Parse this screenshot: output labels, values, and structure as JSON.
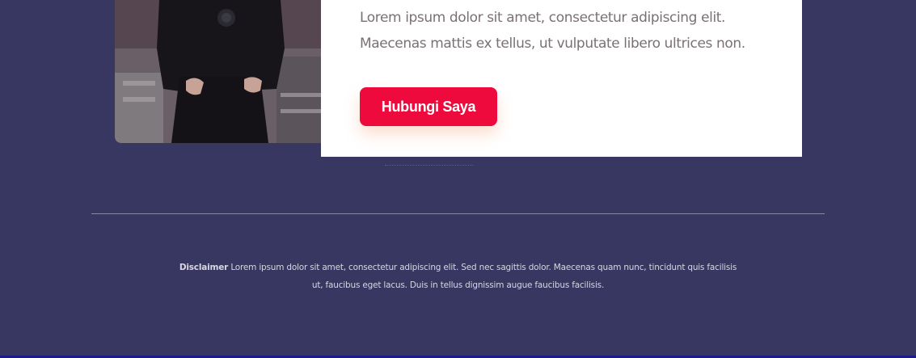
{
  "about": {
    "line1": "Lorem ipsum dolor sit amet, consectetur adipiscing elit.",
    "line2": "Maecenas mattis ex tellus, ut vulputate libero ultrices non."
  },
  "cta": {
    "label": "Hubungi Saya"
  },
  "footer": {
    "disclaimer_label": "Disclaimer",
    "disclaimer_text": "Lorem ipsum dolor sit amet, consectetur adipiscing elit. Sed nec sagittis dolor. Maecenas quam nunc, tincidunt quis facilisis ut, faucibus eget lacus. Duis in tellus dignissim augue faucibus facilisis."
  },
  "colors": {
    "background": "#383761",
    "button": "#ee0a3d",
    "card": "#ffffff"
  }
}
